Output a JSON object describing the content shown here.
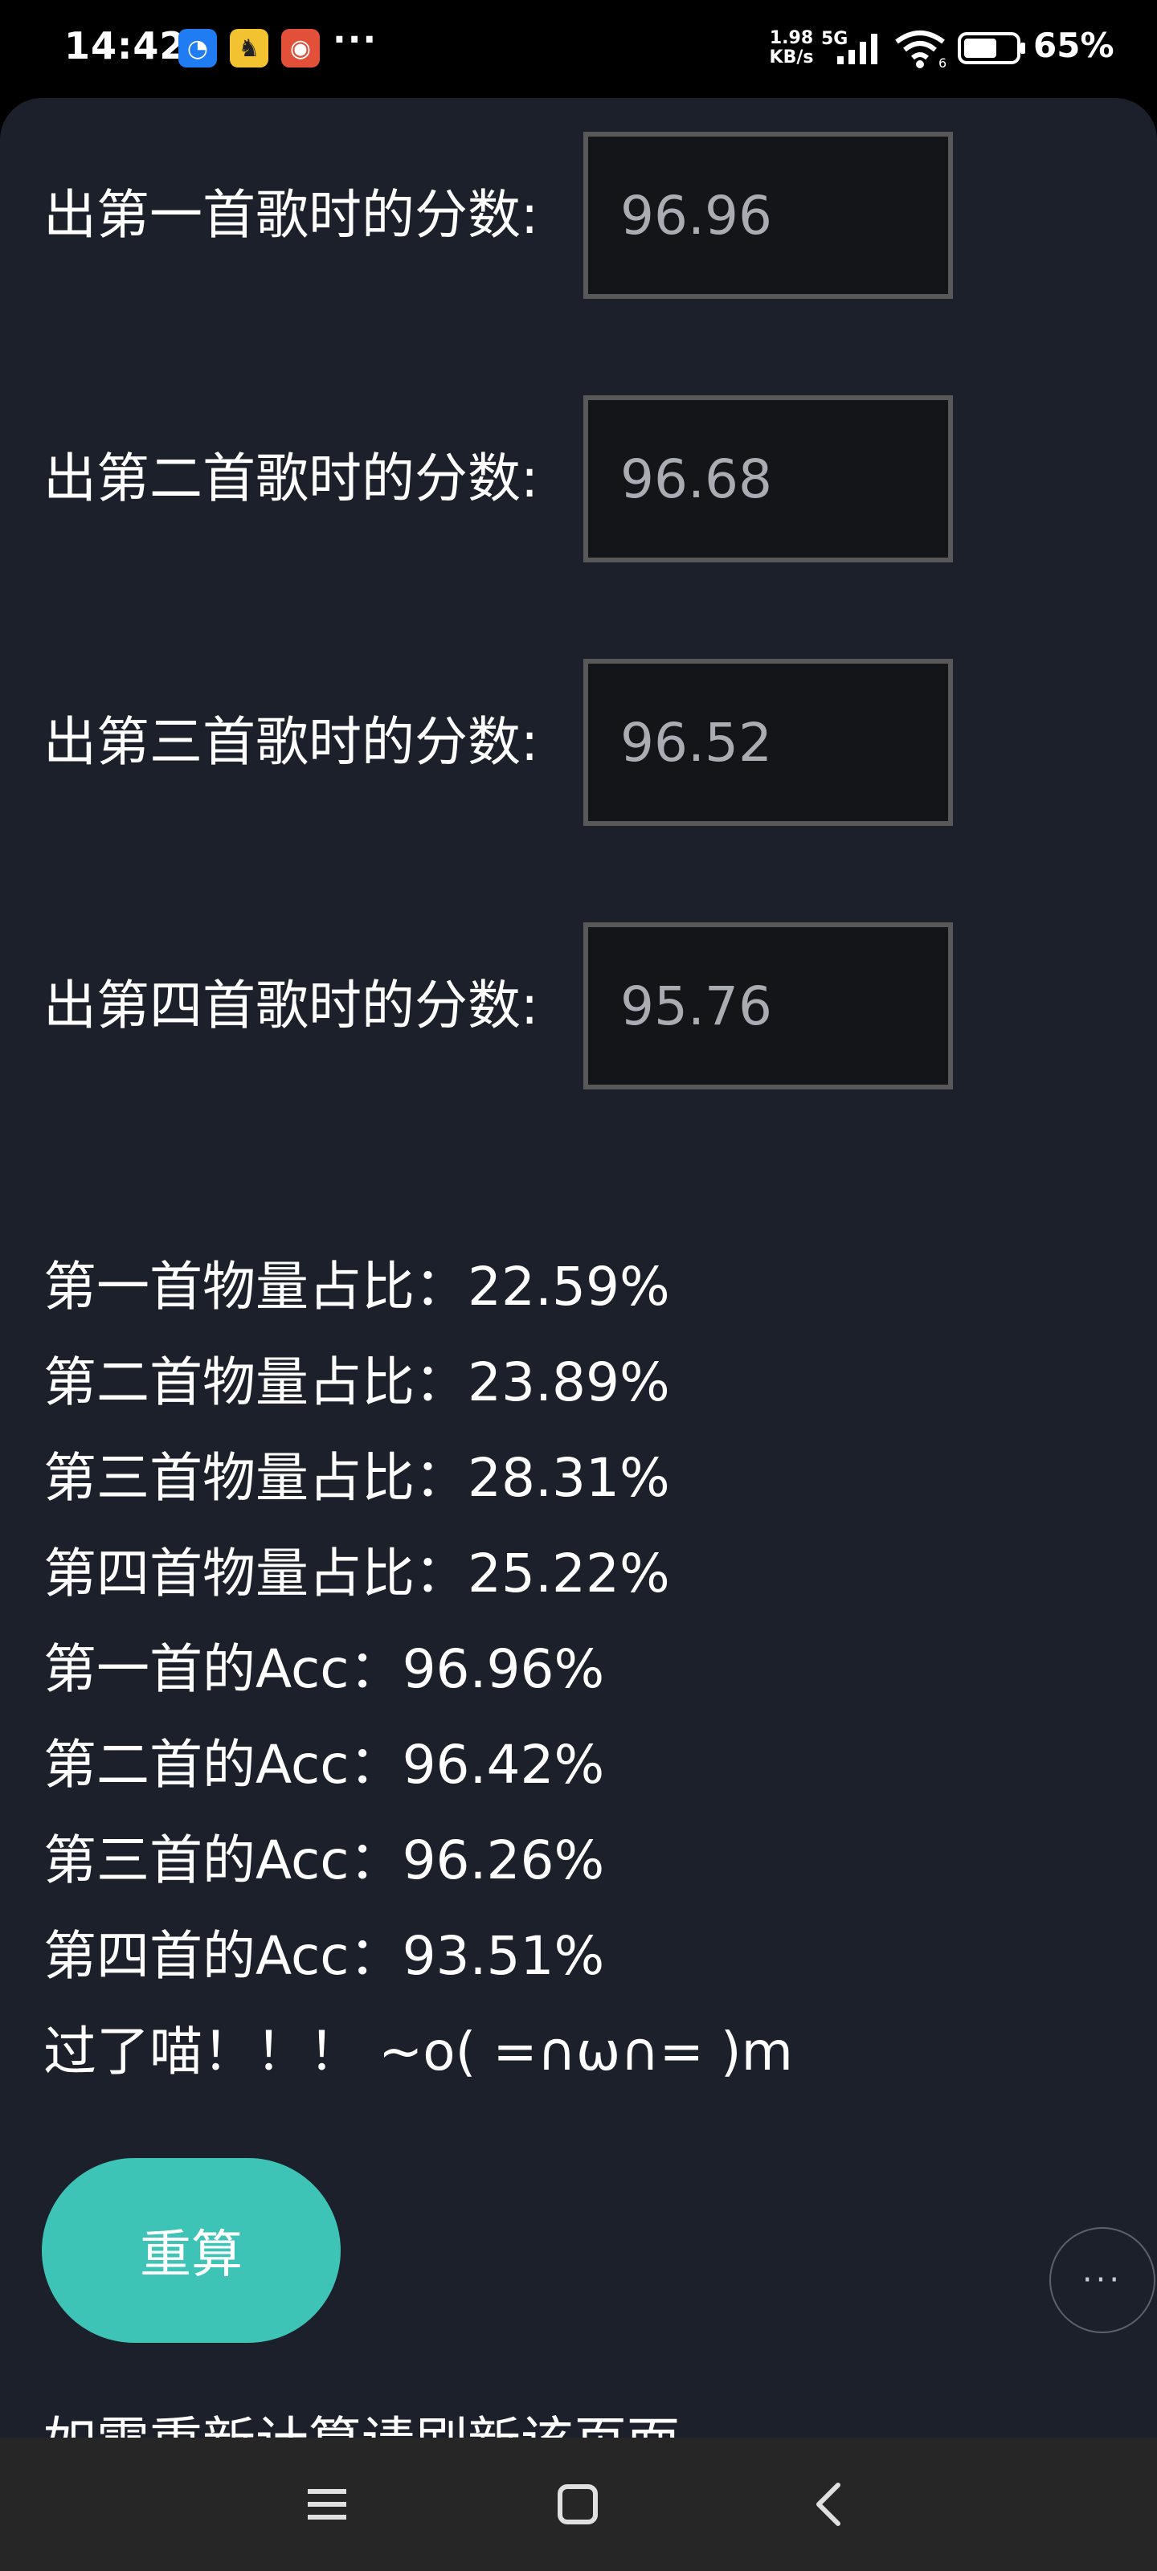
{
  "status_bar": {
    "time": "14:42",
    "more": "···",
    "net_speed_value": "1.98",
    "net_speed_unit": "KB/s",
    "network_type": "5G",
    "battery_level": 65,
    "battery_text": "65%",
    "notification_icons": [
      "browser-app-icon",
      "cat-app-icon",
      "red-app-icon"
    ],
    "accent_colors": {
      "content_bg": "#1b202b",
      "button": "#3ec3b7",
      "input_bg": "#141518",
      "input_border": "#585858"
    }
  },
  "form": {
    "rows": [
      {
        "label": "出第一首歌时的分数:",
        "value": "96.96"
      },
      {
        "label": "出第二首歌时的分数:",
        "value": "96.68"
      },
      {
        "label": "出第三首歌时的分数:",
        "value": "96.52"
      },
      {
        "label": "出第四首歌时的分数:",
        "value": "95.76"
      }
    ]
  },
  "results": {
    "lines": [
      "第一首物量占比：22.59%",
      "第二首物量占比：23.89%",
      "第三首物量占比：28.31%",
      "第四首物量占比：25.22%",
      "第一首的Acc：96.96%",
      "第二首的Acc：96.42%",
      "第三首的Acc：96.26%",
      "第四首的Acc：93.51%",
      "过了喵！！！ ~o( =∩ω∩= )m"
    ]
  },
  "actions": {
    "recalc_label": "重算",
    "float_more_label": "···",
    "refresh_hint": "如需重新计算请刷新该页面"
  },
  "nav_bar": {
    "icons": [
      "menu-icon",
      "home-icon",
      "back-icon"
    ]
  }
}
